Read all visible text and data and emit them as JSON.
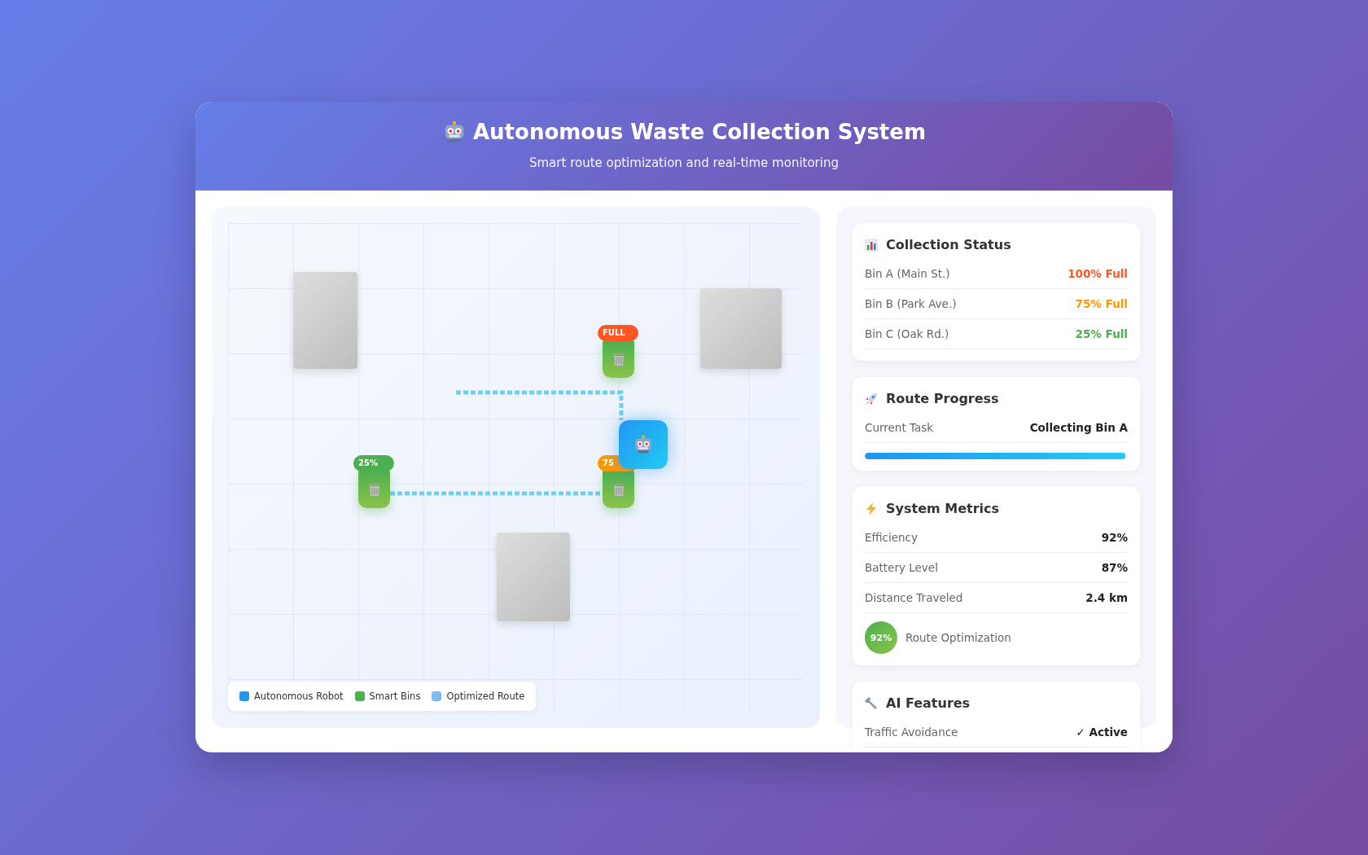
{
  "header": {
    "title": "Autonomous Waste Collection System",
    "subtitle": "Smart route optimization and real-time monitoring"
  },
  "map": {
    "bins": [
      {
        "badge": "FULL",
        "color": "#ff5722"
      },
      {
        "badge": "75",
        "color": "#ff9800"
      },
      {
        "badge": "25%",
        "color": "#4caf50"
      }
    ],
    "legend": [
      {
        "label": "Autonomous Robot",
        "color": "#2196f3"
      },
      {
        "label": "Smart Bins",
        "color": "#4caf50"
      },
      {
        "label": "Optimized Route",
        "color": "#7cbcf2"
      }
    ]
  },
  "panels": [
    {
      "kind": "status",
      "title": "Collection Status",
      "rows": [
        {
          "label": "Bin A (Main St.)",
          "value": "100% Full",
          "color": "#ff5722"
        },
        {
          "label": "Bin B (Park Ave.)",
          "value": "75% Full",
          "color": "#ff9800"
        },
        {
          "label": "Bin C (Oak Rd.)",
          "value": "25% Full",
          "color": "#4caf50"
        }
      ]
    },
    {
      "kind": "progress",
      "title": "Route Progress",
      "rows": [
        {
          "label": "Current Task",
          "value": "Collecting Bin A"
        }
      ],
      "level": 0.99
    },
    {
      "kind": "metrics",
      "title": "System Metrics",
      "rows": [
        {
          "label": "Efficiency",
          "value": "92%"
        },
        {
          "label": "Battery Level",
          "value": "87%"
        },
        {
          "label": "Distance Traveled",
          "value": "2.4 km"
        }
      ],
      "gauge": {
        "value": "92%",
        "label": "Route Optimization"
      }
    },
    {
      "kind": "features",
      "title": "AI Features",
      "rows": [
        {
          "label": "Traffic Avoidance",
          "value": "✓ Active"
        }
      ]
    }
  ]
}
